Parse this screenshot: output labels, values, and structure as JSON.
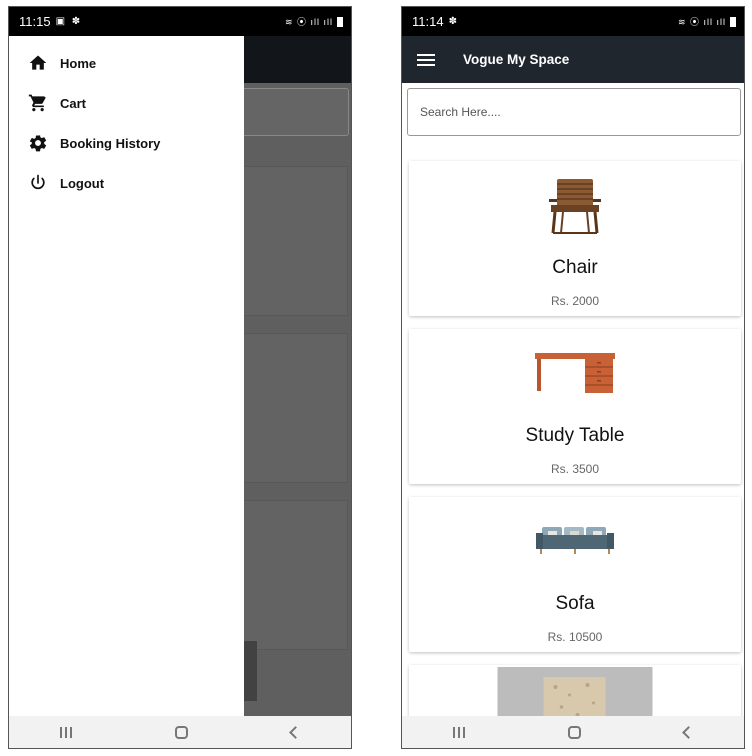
{
  "left_screen": {
    "status_time": "11:15",
    "drawer": {
      "items": [
        {
          "icon": "home-icon",
          "label": "Home"
        },
        {
          "icon": "cart-icon",
          "label": "Cart"
        },
        {
          "icon": "gear-icon",
          "label": "Booking History"
        },
        {
          "icon": "power-icon",
          "label": "Logout"
        }
      ]
    }
  },
  "right_screen": {
    "status_time": "11:14",
    "app_title": "Vogue My Space",
    "search": {
      "placeholder": "Search Here...."
    },
    "products": [
      {
        "name": "Chair",
        "price": "Rs. 2000",
        "icon": "chair-image"
      },
      {
        "name": "Study Table",
        "price": "Rs. 3500",
        "icon": "study-table-image"
      },
      {
        "name": "Sofa",
        "price": "Rs. 10500",
        "icon": "sofa-image"
      },
      {
        "name": "",
        "price": "",
        "icon": "rug-image"
      }
    ]
  },
  "colors": {
    "appbar": "#1f262d",
    "statusbar": "#000000",
    "scrim": "#5f5f5f"
  }
}
